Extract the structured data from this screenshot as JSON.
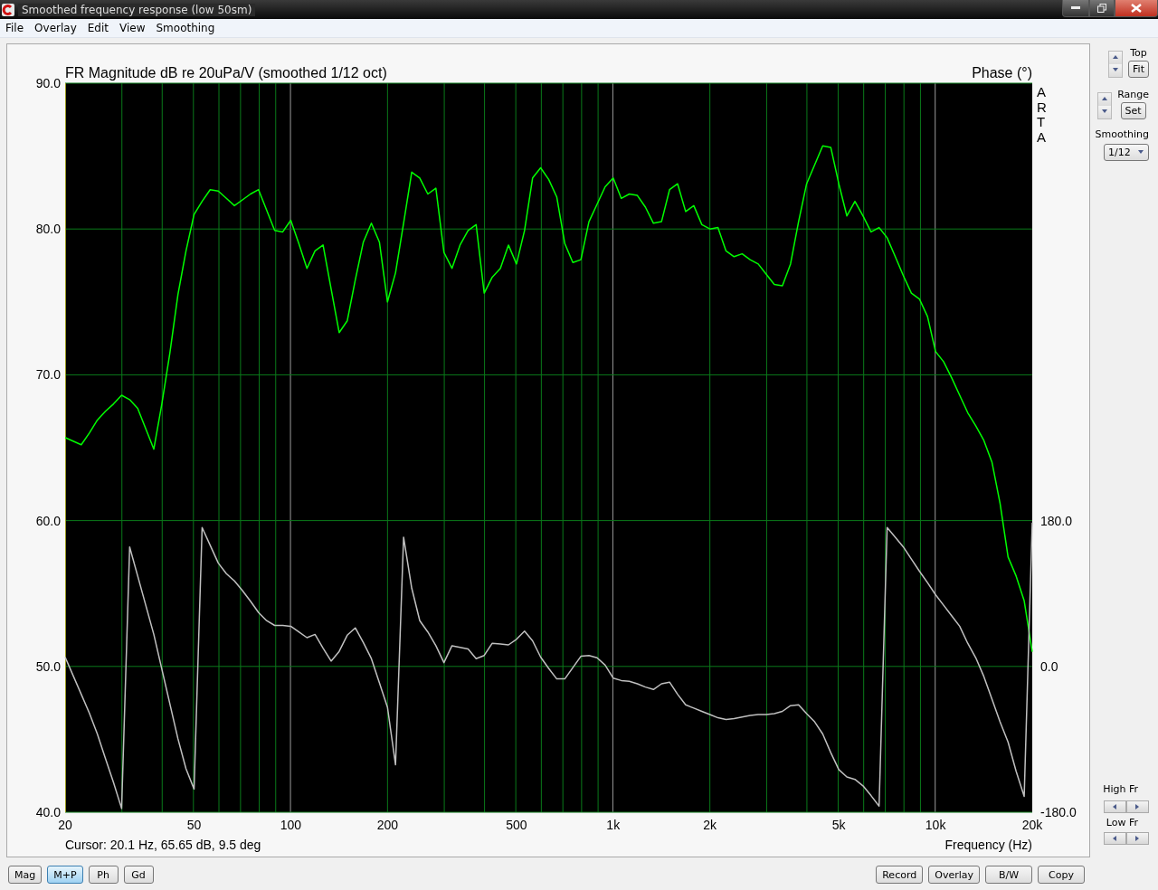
{
  "window": {
    "title": "Smoothed frequency response (low 50sm)"
  },
  "menu": [
    "File",
    "Overlay",
    "Edit",
    "View",
    "Smoothing"
  ],
  "plot": {
    "brand_mark": "ARTA",
    "magnitude_chart": {
      "chart_data": {
        "type": "line",
        "title": "FR Magnitude dB re 20uPa/V (smoothed 1/12 oct)",
        "xlabel": "Frequency (Hz)",
        "grid": true,
        "ylim": [
          40,
          90
        ],
        "yticks": [
          {
            "value": 40,
            "label": "40.0"
          },
          {
            "value": 50,
            "label": "50.0"
          },
          {
            "value": 60,
            "label": "60.0"
          },
          {
            "value": 70,
            "label": "70.0"
          },
          {
            "value": 80,
            "label": "80.0"
          },
          {
            "value": 90,
            "label": "90.0"
          }
        ],
        "categories": [
          "20",
          null,
          null,
          null,
          null,
          null,
          null,
          null,
          null,
          null,
          null,
          null,
          null,
          null,
          null,
          null,
          "50",
          null,
          null,
          null,
          null,
          null,
          null,
          null,
          null,
          null,
          null,
          null,
          "100",
          null,
          null,
          null,
          null,
          null,
          null,
          null,
          null,
          null,
          null,
          null,
          "200",
          null,
          null,
          null,
          null,
          null,
          null,
          null,
          null,
          null,
          null,
          null,
          null,
          null,
          null,
          null,
          "500",
          null,
          null,
          null,
          null,
          null,
          null,
          null,
          null,
          null,
          null,
          null,
          "1k",
          null,
          null,
          null,
          null,
          null,
          null,
          null,
          null,
          null,
          null,
          null,
          "2k",
          null,
          null,
          null,
          null,
          null,
          null,
          null,
          null,
          null,
          null,
          null,
          null,
          null,
          null,
          null,
          "5k",
          null,
          null,
          null,
          null,
          null,
          null,
          null,
          null,
          null,
          null,
          null,
          "10k",
          null,
          null,
          null,
          null,
          null,
          null,
          null,
          null,
          null,
          null,
          null,
          "20k"
        ],
        "series": [
          {
            "color": "#00ff00",
            "values": [
              65.7,
              65.45,
              65.2,
              66.0,
              66.9,
              67.5,
              68.0,
              68.6,
              68.3,
              67.7,
              66.3,
              64.9,
              68.0,
              71.5,
              75.5,
              78.5,
              81.0,
              81.9,
              82.7,
              82.6,
              82.1,
              81.6,
              82.0,
              82.4,
              82.7,
              81.3,
              79.9,
              79.8,
              80.6,
              79.0,
              77.3,
              78.5,
              78.9,
              75.9,
              72.9,
              73.7,
              76.5,
              79.1,
              80.4,
              79.1,
              75.0,
              77.0,
              80.4,
              83.9,
              83.5,
              82.4,
              82.8,
              78.4,
              77.3,
              78.9,
              79.9,
              80.3,
              75.6,
              76.7,
              77.3,
              78.9,
              77.6,
              79.9,
              83.5,
              84.2,
              83.4,
              82.2,
              79.0,
              77.7,
              77.9,
              80.5,
              81.7,
              82.9,
              83.5,
              82.1,
              82.4,
              82.3,
              81.5,
              80.4,
              80.5,
              82.7,
              83.1,
              81.2,
              81.6,
              80.3,
              80.0,
              80.1,
              78.5,
              78.1,
              78.3,
              77.9,
              77.6,
              76.9,
              76.2,
              76.1,
              77.6,
              80.5,
              83.1,
              84.4,
              85.7,
              85.6,
              83.1,
              80.9,
              81.9,
              80.9,
              79.8,
              80.1,
              79.4,
              78.1,
              76.8,
              75.6,
              75.2,
              74.0,
              71.6,
              70.9,
              69.8,
              68.6,
              67.4,
              66.5,
              65.5,
              64.0,
              61.2,
              57.5,
              56.2,
              54.5,
              51.0
            ]
          }
        ]
      }
    },
    "phase_chart": {
      "chart_data": {
        "type": "line",
        "ylabel": "Phase (°)",
        "ylim": [
          -180,
          180
        ],
        "yticks": [
          {
            "value": -180,
            "label": "-180.0"
          },
          {
            "value": 0,
            "label": "0.0"
          },
          {
            "value": 180,
            "label": "180.0"
          }
        ],
        "categories": [
          null,
          null,
          null,
          null,
          null,
          null,
          null,
          null,
          null,
          null,
          null,
          null,
          null,
          null,
          null,
          null,
          null,
          null,
          null,
          null,
          null,
          null,
          null,
          null,
          null,
          null,
          null,
          null,
          null,
          null,
          null,
          null,
          null,
          null,
          null,
          null,
          null,
          null,
          null,
          null,
          null,
          null,
          null,
          null,
          null,
          null,
          null,
          null,
          null,
          null,
          null,
          null,
          null,
          null,
          null,
          null,
          null,
          null,
          null,
          null,
          null,
          null,
          null,
          null,
          null,
          null,
          null,
          null,
          null,
          null,
          null,
          null,
          null,
          null,
          null,
          null,
          null,
          null,
          null,
          null,
          null,
          null,
          null,
          null,
          null,
          null,
          null,
          null,
          null,
          null,
          null,
          null,
          null,
          null,
          null,
          null,
          null,
          null,
          null,
          null,
          null,
          null,
          null,
          null,
          null,
          null,
          null,
          null,
          null,
          null,
          null,
          null,
          null,
          null,
          null,
          null,
          null,
          null,
          null,
          null,
          null
        ],
        "series": [
          {
            "color": "#c0c0c0",
            "values": [
              12,
              -11,
              -34,
              -57,
              -83,
              -113,
              -143,
              -175,
              148,
              112,
              76,
              40,
              -3,
              -46,
              -89,
              -126,
              -151,
              172,
              150,
              128,
              115,
              106,
              94,
              81,
              67,
              57,
              51,
              51,
              50,
              43,
              36,
              40,
              23,
              7,
              19,
              39,
              48,
              30,
              10,
              -20,
              -50,
              -121,
              160,
              97,
              57,
              43,
              26,
              5,
              26,
              24,
              22,
              10,
              14,
              29,
              28,
              27,
              34,
              44,
              32,
              12,
              -2,
              -15,
              -15,
              -1,
              13,
              14,
              11,
              2,
              -14,
              -17,
              -18,
              -21,
              -25,
              -28,
              -21,
              -19,
              -34,
              -47,
              -51,
              -55,
              -59,
              -63,
              -65,
              -64,
              -62,
              -60,
              -59,
              -59,
              -58,
              -55,
              -48,
              -47,
              -58,
              -68,
              -83,
              -106,
              -127,
              -136,
              -139,
              -147,
              -159,
              -172,
              172,
              160,
              148,
              133,
              118,
              104,
              89,
              76,
              63,
              50,
              29,
              11,
              -12,
              -40,
              -68,
              -93,
              -129,
              -160,
              178
            ]
          }
        ]
      }
    },
    "cursor_readout": "Cursor: 20.1 Hz, 65.65 dB, 9.5 deg"
  },
  "side_panel": {
    "top_label": "Top",
    "fit_button": "Fit",
    "range_label": "Range",
    "set_button": "Set",
    "smoothing_label": "Smoothing",
    "smoothing_value": "1/12",
    "high_fr_label": "High Fr",
    "low_fr_label": "Low Fr"
  },
  "view_buttons": [
    {
      "label": "Mag",
      "selected": false
    },
    {
      "label": "M+P",
      "selected": true
    },
    {
      "label": "Ph",
      "selected": false
    },
    {
      "label": "Gd",
      "selected": false
    }
  ],
  "action_buttons": [
    "Record",
    "Overlay",
    "B/W",
    "Copy"
  ]
}
